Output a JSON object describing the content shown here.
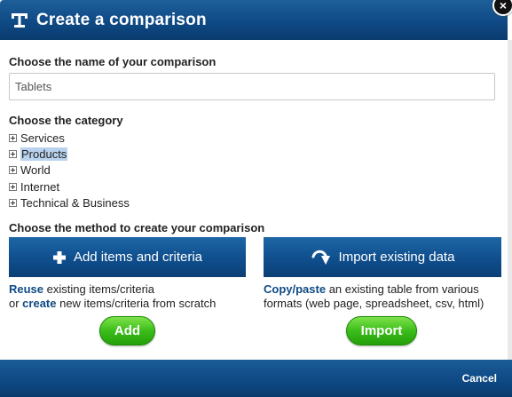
{
  "dialog": {
    "title": "Create a comparison",
    "close_label": "×",
    "cancel_label": "Cancel"
  },
  "name_section": {
    "label": "Choose the name of your comparison",
    "input_value": "Tablets"
  },
  "category_section": {
    "label": "Choose the category",
    "items": [
      {
        "label": "Services",
        "selected": false
      },
      {
        "label": "Products",
        "selected": true
      },
      {
        "label": "World",
        "selected": false
      },
      {
        "label": "Internet",
        "selected": false
      },
      {
        "label": "Technical & Business",
        "selected": false
      }
    ]
  },
  "method_section": {
    "label": "Choose the method to create your comparison",
    "add": {
      "button_label": "Add items and criteria",
      "icon": "plus-icon",
      "desc_link1": "Reuse",
      "desc_text1": " existing items/criteria",
      "desc_text2_prefix": "or ",
      "desc_link2": "create",
      "desc_text2": " new items/criteria from scratch",
      "action_label": "Add"
    },
    "import": {
      "button_label": "Import existing data",
      "icon": "curved-arrow-down-icon",
      "desc_link1": "Copy/paste",
      "desc_text1": " an existing table from various",
      "desc_text2": "formats (web page, spreadsheet, csv, html)",
      "action_label": "Import"
    }
  },
  "colors": {
    "header_blue": "#0f4a85",
    "link_blue": "#0f4a85",
    "green": "#3cbd1b",
    "selection": "#b9d3ef"
  }
}
